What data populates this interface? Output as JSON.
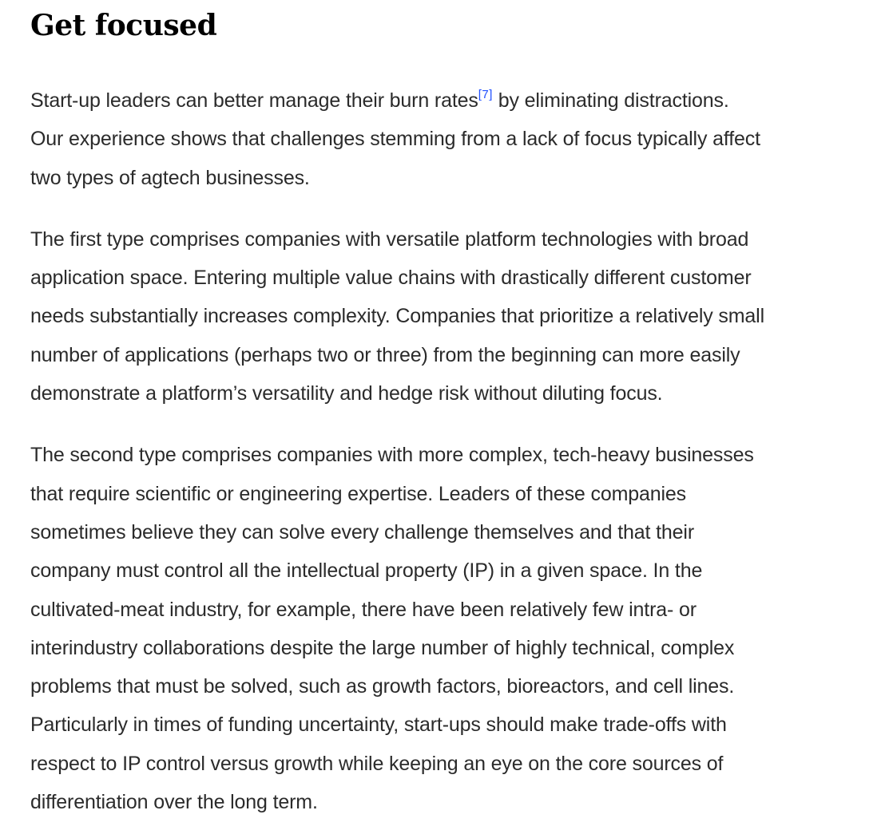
{
  "section": {
    "heading": "Get focused",
    "footnote_color": "#2251ff"
  },
  "paragraphs": [
    {
      "lines": [
        {
          "before": "Start-up leaders can better manage their burn rates",
          "footnote": "[7]",
          "after": " by eliminating distractions."
        },
        {
          "text": "Our experience shows that challenges stemming from a lack of focus typically affect"
        },
        {
          "text": "two types of agtech businesses."
        }
      ]
    },
    {
      "lines": [
        {
          "text": "The first type comprises companies with versatile platform technologies with broad"
        },
        {
          "text": "application space. Entering multiple value chains with drastically different customer"
        },
        {
          "text": "needs substantially increases complexity. Companies that prioritize a relatively small"
        },
        {
          "text": "number of applications (perhaps two or three) from the beginning can more easily"
        },
        {
          "text": "demonstrate a platform’s versatility and hedge risk without diluting focus."
        }
      ]
    },
    {
      "lines": [
        {
          "text": "The second type comprises companies with more complex, tech-heavy businesses"
        },
        {
          "text": "that require scientific or engineering expertise. Leaders of these companies"
        },
        {
          "text": "sometimes believe they can solve every challenge themselves and that their"
        },
        {
          "text": "company must control all the intellectual property (IP) in a given space. In the"
        },
        {
          "text": "cultivated-meat industry, for example, there have been relatively few intra- or"
        },
        {
          "text": "interindustry collaborations despite the large number of highly technical, complex"
        },
        {
          "text": "problems that must be solved, such as growth factors, bioreactors, and cell lines."
        },
        {
          "text": "Particularly in times of funding uncertainty, start-ups should make trade-offs with"
        },
        {
          "text": "respect to IP control versus growth while keeping an eye on the core sources of"
        },
        {
          "text": "differentiation over the long term."
        }
      ]
    }
  ]
}
